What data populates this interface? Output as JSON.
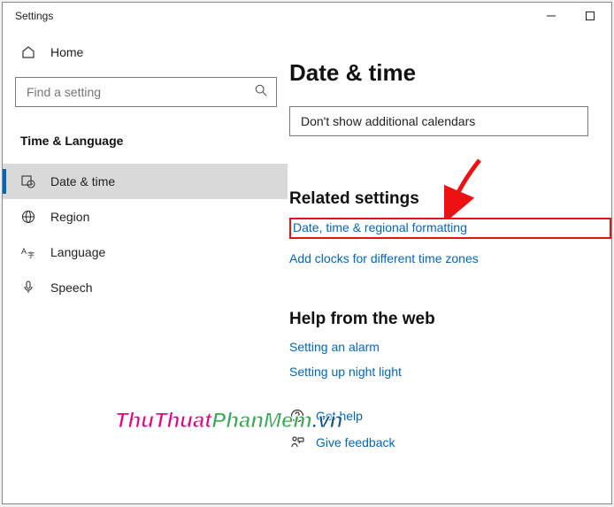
{
  "app_title": "Settings",
  "sidebar": {
    "home": "Home",
    "search_placeholder": "Find a setting",
    "section": "Time & Language",
    "items": [
      {
        "label": "Date & time",
        "icon": "calendar-clock-icon",
        "active": true
      },
      {
        "label": "Region",
        "icon": "globe-icon",
        "active": false
      },
      {
        "label": "Language",
        "icon": "language-icon",
        "active": false
      },
      {
        "label": "Speech",
        "icon": "microphone-icon",
        "active": false
      }
    ]
  },
  "main": {
    "title": "Date & time",
    "dropdown_value": "Don't show additional calendars",
    "related_heading": "Related settings",
    "related_links": [
      "Date, time & regional formatting",
      "Add clocks for different time zones"
    ],
    "help_heading": "Help from the web",
    "help_links": [
      "Setting an alarm",
      "Setting up night light"
    ],
    "bottom": [
      {
        "label": "Get help",
        "icon": "help-icon"
      },
      {
        "label": "Give feedback",
        "icon": "feedback-icon"
      }
    ]
  },
  "watermark": {
    "a": "ThuThuat",
    "b": "PhanMem",
    "c": ".vn"
  }
}
